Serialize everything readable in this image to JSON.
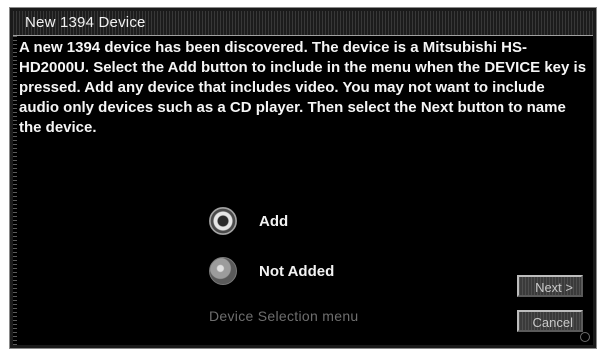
{
  "dialog": {
    "title": "New 1394 Device",
    "message": "A new 1394 device has been discovered. The device is a Mitsubishi HS-HD2000U. Select the Add button to include in the menu when the DEVICE key is pressed. Add any device that includes video. You may not want to include audio only devices such as a CD player. Then select the Next button to name the device."
  },
  "options": [
    {
      "label": "Add",
      "selected": true
    },
    {
      "label": "Not Added",
      "selected": false
    }
  ],
  "caption": "Device Selection menu",
  "buttons": {
    "next_label": "Next >",
    "cancel_label": "Cancel"
  },
  "icons": {
    "selected_radio": "radio-selected-icon",
    "unselected_radio": "radio-unselected-icon"
  }
}
